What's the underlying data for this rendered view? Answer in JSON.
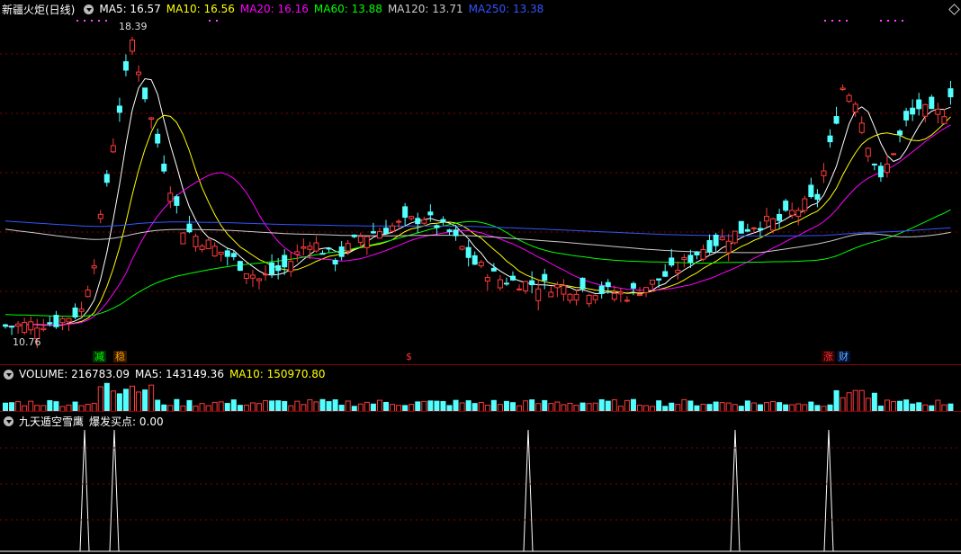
{
  "price": {
    "title": "新疆火炬(日线)",
    "ma": [
      {
        "label": "MA5: 16.57",
        "color": "#ffffff"
      },
      {
        "label": "MA10: 16.56",
        "color": "#ffff00"
      },
      {
        "label": "MA20: 16.16",
        "color": "#ff00ff"
      },
      {
        "label": "MA60: 13.88",
        "color": "#00ff00"
      },
      {
        "label": "MA120: 13.71",
        "color": "#cccccc"
      },
      {
        "label": "MA250: 13.38",
        "color": "#3355ff"
      }
    ],
    "high_label": "18.39",
    "low_label": "10.76",
    "signals": [
      {
        "text": "减",
        "color": "#00ff00",
        "bg": "#003300"
      },
      {
        "text": "稳",
        "color": "#ff9900",
        "bg": "#331a00"
      },
      {
        "text": "$",
        "color": "#ff3333",
        "bg": "transparent"
      },
      {
        "text": "涨",
        "color": "#ff3333",
        "bg": "#330000"
      },
      {
        "text": "财",
        "color": "#66aaff",
        "bg": "#001133"
      }
    ]
  },
  "volume": {
    "label": "VOLUME: 216783.09",
    "ma5": "MA5: 143149.36",
    "ma10": "MA10: 150970.80",
    "colors": {
      "label": "#ffffff",
      "ma5": "#ffffff",
      "ma10": "#ffff00"
    }
  },
  "indicator": {
    "name": "九天遁空雪鹰",
    "value": "爆发买点: 0.00"
  },
  "colors": {
    "up": "#ff3b3b",
    "down": "#54ffff",
    "background": "#000000",
    "grid": "#8b0000"
  }
}
